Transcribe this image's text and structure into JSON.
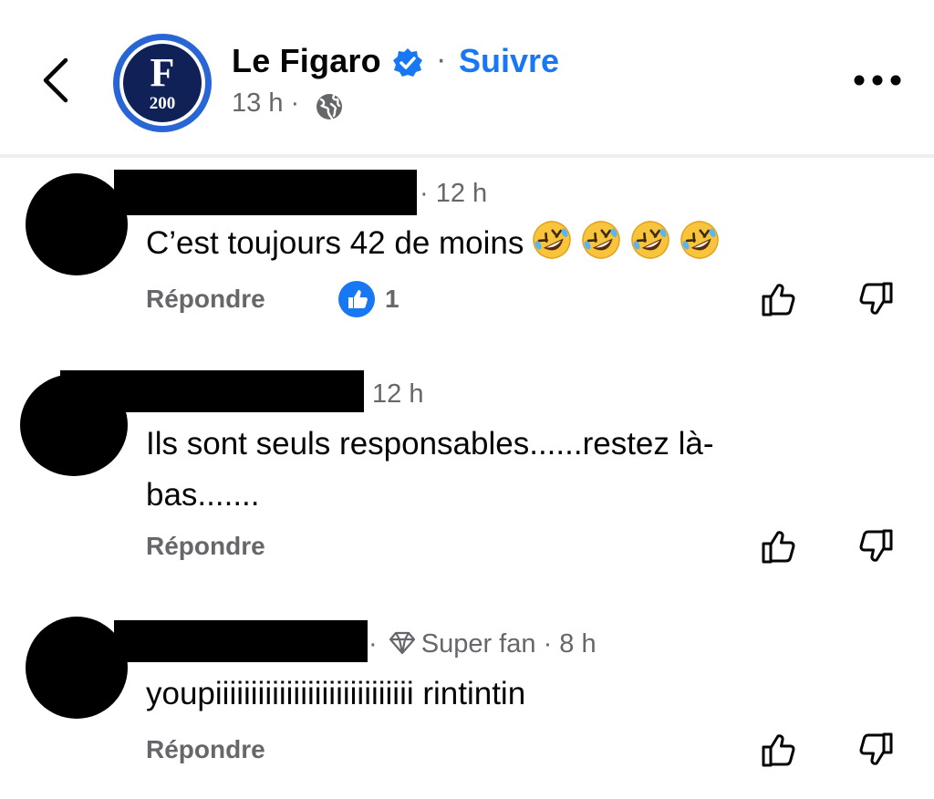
{
  "header": {
    "back_icon": "chevron-left-icon",
    "page_name": "Le Figaro",
    "logo": {
      "letter": "F",
      "year": "200"
    },
    "verified_icon": "verified-badge-icon",
    "dot": "·",
    "follow_label": "Suivre",
    "post_time": "13 h ·",
    "audience_icon": "globe-icon",
    "more_icon": "more-horizontal-icon"
  },
  "colors": {
    "link_blue": "#1877f2",
    "secondary_text": "#65676b",
    "logo_navy": "#0f2157",
    "logo_ring": "#2866d6"
  },
  "comments": [
    {
      "meta": "· 12 h",
      "text": "C’est toujours 42 de moins",
      "emoji_icons": [
        "rolling-on-floor-laughing-icon",
        "rolling-on-floor-laughing-icon",
        "rolling-on-floor-laughing-icon",
        "rolling-on-floor-laughing-icon"
      ],
      "reply_label": "Répondre",
      "reaction_count": "1",
      "reaction_icon": "like-reaction-icon"
    },
    {
      "meta": "12 h",
      "text_line1": "Ils sont seuls responsables......restez là-",
      "text_line2": "bas.......",
      "reply_label": "Répondre"
    },
    {
      "meta_prefix": "·",
      "badge_icon": "diamond-icon",
      "badge_label": "Super fan",
      "meta_suffix": "· 8 h",
      "text": "youpiiiiiiiiiiiiiiiiiiiiiiiiiiii rintintin",
      "reply_label": "Répondre"
    }
  ]
}
